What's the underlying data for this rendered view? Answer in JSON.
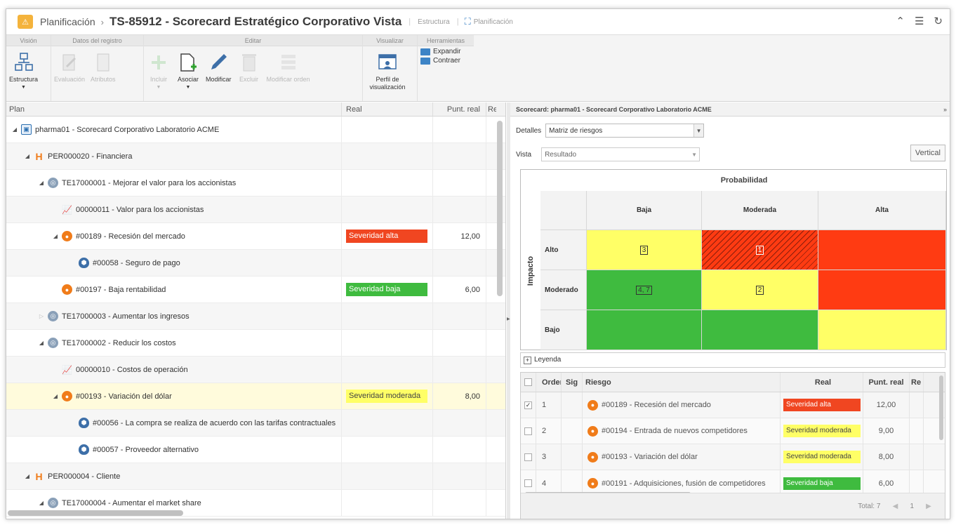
{
  "title": {
    "breadcrumb_root": "Planificación",
    "separator": "›",
    "doc_title": "TS-85912 - Scorecard Estratégico Corporativo Vista",
    "link_estructura": "Estructura",
    "link_planificacion": "Planificación"
  },
  "ribbon": {
    "groups": {
      "vision": "Visión",
      "datos": "Datos del registro",
      "editar": "Editar",
      "visualizar": "Visualizar",
      "herramientas": "Herramientas"
    },
    "buttons": {
      "estructura": "Estructura",
      "evaluacion": "Evaluación",
      "atributos": "Atributos",
      "incluir": "Incluir",
      "asociar": "Asociar",
      "modificar": "Modificar",
      "excluir": "Excluir",
      "modificar_orden": "Modificar orden",
      "perfil": "Perfil de visualización",
      "expandir": "Expandir",
      "contraer": "Contraer"
    }
  },
  "left_grid": {
    "headers": {
      "plan": "Plan",
      "real": "Real",
      "punt_real": "Punt. real",
      "res": "Res"
    },
    "rows": [
      {
        "label": "pharma01 - Scorecard Corporativo Laboratorio ACME",
        "real": "",
        "score": ""
      },
      {
        "label": "PER000020 - Financiera",
        "real": "",
        "score": ""
      },
      {
        "label": "TE17000001 - Mejorar el valor para los accionistas",
        "real": "",
        "score": ""
      },
      {
        "label": "00000011 - Valor para los accionistas",
        "real": "",
        "score": ""
      },
      {
        "label": "#00189 - Recesión del mercado",
        "real": "Severidad alta",
        "score": "12,00"
      },
      {
        "label": "#00058 - Seguro de pago",
        "real": "",
        "score": ""
      },
      {
        "label": "#00197 - Baja rentabilidad",
        "real": "Severidad baja",
        "score": "6,00"
      },
      {
        "label": "TE17000003 - Aumentar los ingresos",
        "real": "",
        "score": ""
      },
      {
        "label": "TE17000002 - Reducir los costos",
        "real": "",
        "score": ""
      },
      {
        "label": "00000010 - Costos de operación",
        "real": "",
        "score": ""
      },
      {
        "label": "#00193 - Variación del dólar",
        "real": "Severidad moderada",
        "score": "8,00"
      },
      {
        "label": "#00056 - La compra se realiza de acuerdo con las tarifas contractuales",
        "real": "",
        "score": ""
      },
      {
        "label": "#00057 - Proveedor alternativo",
        "real": "",
        "score": ""
      },
      {
        "label": "PER000004 - Cliente",
        "real": "",
        "score": ""
      },
      {
        "label": "TE17000004 - Aumentar el market share",
        "real": "",
        "score": ""
      }
    ]
  },
  "right_panel": {
    "header": "Scorecard: pharma01 - Scorecard Corporativo Laboratorio ACME",
    "collapse": "»",
    "detalles_label": "Detalles",
    "detalles_value": "Matriz de riesgos",
    "vista_label": "Vista",
    "vista_value": "Resultado",
    "vertical_button": "Vertical",
    "matrix": {
      "title": "Probabilidad",
      "side": "Impacto",
      "cols": [
        "Baja",
        "Moderada",
        "Alta"
      ],
      "rows": [
        "Alto",
        "Moderado",
        "Bajo"
      ],
      "cells": [
        [
          "3",
          "1",
          ""
        ],
        [
          "4, 7",
          "2",
          ""
        ],
        [
          "",
          "",
          ""
        ]
      ],
      "colors": {
        "yellow": "#ffff66",
        "green": "#3fbb3f",
        "red": "#ff3b12"
      }
    },
    "leyenda": "Leyenda",
    "table": {
      "headers": {
        "orden": "Orden",
        "sig": "Sig",
        "riesgo": "Riesgo",
        "real": "Real",
        "punt_real": "Punt. real",
        "re": "Re"
      },
      "rows": [
        {
          "orden": "1",
          "riesgo": "#00189 - Recesión del mercado",
          "real": "Severidad alta",
          "score": "12,00",
          "checked": true
        },
        {
          "orden": "2",
          "riesgo": "#00194 - Entrada de nuevos competidores",
          "real": "Severidad moderada",
          "score": "9,00",
          "checked": false
        },
        {
          "orden": "3",
          "riesgo": "#00193 - Variación del dólar",
          "real": "Severidad moderada",
          "score": "8,00",
          "checked": false
        },
        {
          "orden": "4",
          "riesgo": "#00191 - Adquisiciones, fusión de competidores",
          "real": "Severidad baja",
          "score": "6,00",
          "checked": false
        }
      ],
      "total": "Total: 7",
      "page": "1"
    }
  }
}
